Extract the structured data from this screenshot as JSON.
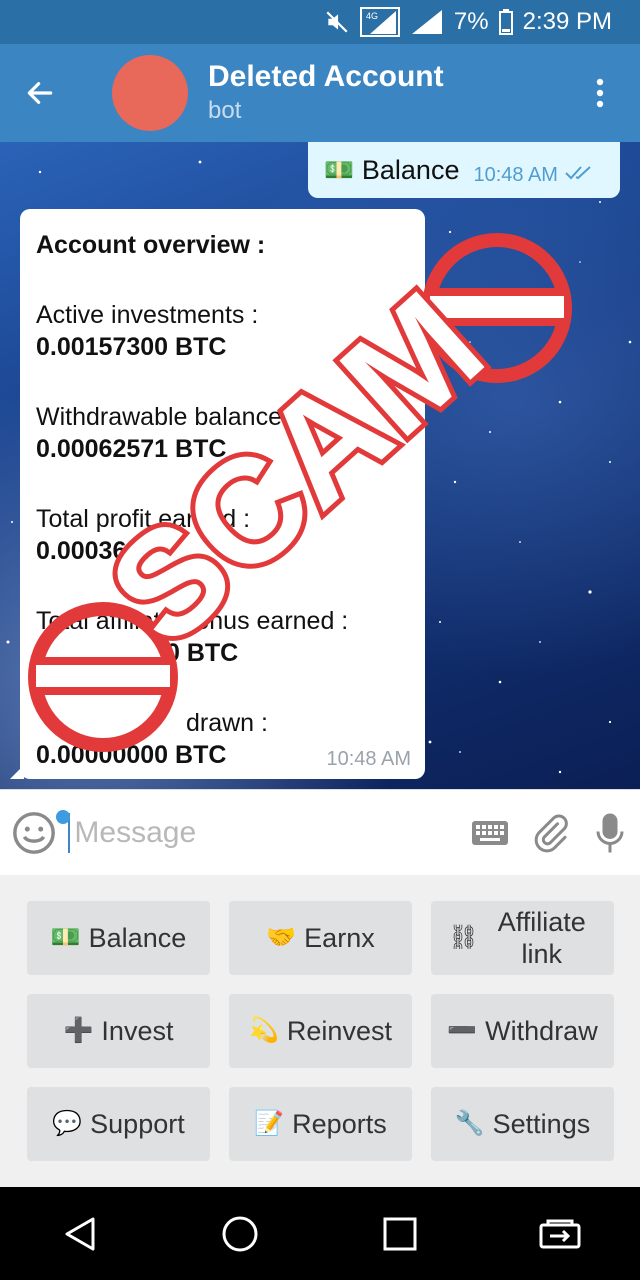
{
  "status_bar": {
    "network": "4G",
    "battery": "7%",
    "time": "2:39 PM"
  },
  "header": {
    "title": "Deleted Account",
    "subtitle": "bot",
    "avatar_color": "#e8685a"
  },
  "messages": {
    "outgoing": {
      "text": "Balance",
      "time": "10:48 AM"
    },
    "incoming": {
      "heading": "Account overview :",
      "lines": [
        {
          "label": "Active investments :",
          "value": "0.00157300 BTC"
        },
        {
          "label": "Withdrawable balance :",
          "value": "0.00062571 BTC"
        },
        {
          "label": "Total profit earned :",
          "value": "0.0003637"
        },
        {
          "label": "Total affiliate bonus earned :",
          "value": "0 BTC"
        },
        {
          "label": "drawn :",
          "value": "0.00000000 BTC"
        }
      ],
      "time": "10:48 AM"
    }
  },
  "overlay": {
    "text": "SCAM",
    "color": "#e23a3a"
  },
  "input": {
    "placeholder": "Message"
  },
  "keyboard": {
    "buttons": [
      {
        "emoji": "💵",
        "label": "Balance"
      },
      {
        "emoji": "🤝",
        "label": "Earnx"
      },
      {
        "emoji": "⛓",
        "label": "Affiliate link"
      },
      {
        "emoji": "➕",
        "label": "Invest"
      },
      {
        "emoji": "💫",
        "label": "Reinvest"
      },
      {
        "emoji": "➖",
        "label": "Withdraw"
      },
      {
        "emoji": "💬",
        "label": "Support"
      },
      {
        "emoji": "📝",
        "label": "Reports"
      },
      {
        "emoji": "🔧",
        "label": "Settings"
      }
    ]
  },
  "icons": {
    "back": "back-arrow-icon",
    "menu": "more-vertical-icon",
    "emoji": "emoji-icon",
    "keyboard": "keyboard-icon",
    "attach": "paperclip-icon",
    "mic": "microphone-icon"
  }
}
